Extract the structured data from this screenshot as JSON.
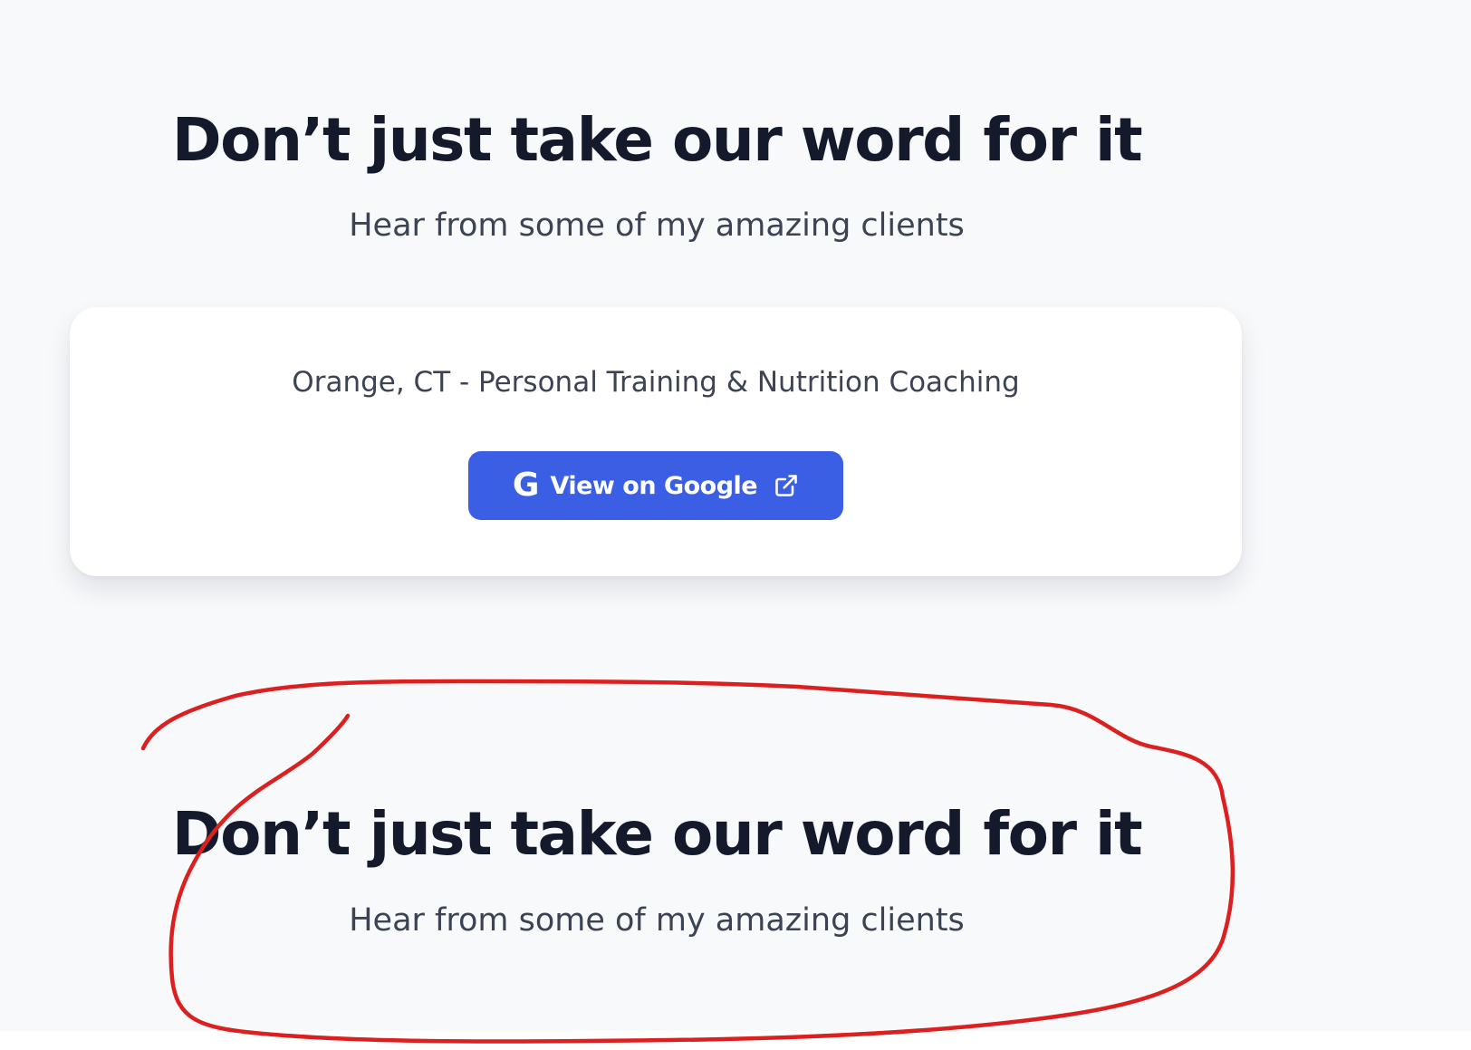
{
  "section_top": {
    "heading": "Don’t just take our word for it",
    "subheading": "Hear from some of my amazing clients"
  },
  "card": {
    "title": "Orange, CT - Personal Training & Nutrition Coaching",
    "button": {
      "icon": "google-g-icon",
      "label": "View on Google",
      "trailing_icon": "external-link-icon",
      "color": "#3b5fe4"
    }
  },
  "section_bottom": {
    "heading": "Don’t just take our word for it",
    "subheading": "Hear from some of my amazing clients"
  },
  "annotation": {
    "type": "hand-drawn circle",
    "color": "#dc1f1f"
  }
}
